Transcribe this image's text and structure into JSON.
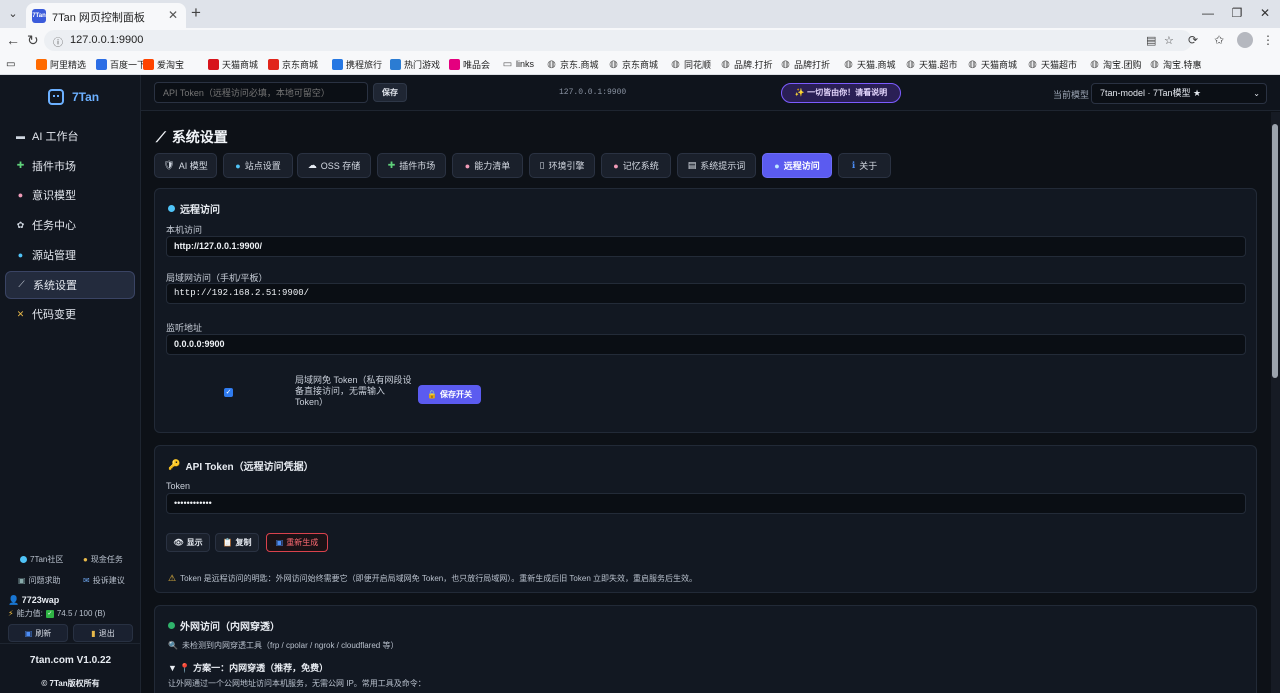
{
  "browser": {
    "tab_title": "7Tan 网页控制面板",
    "tab_favicon": "7Tan",
    "url": "127.0.0.1:9900",
    "bookmarks": [
      {
        "label": "阿里精选",
        "color": "#ff6a00"
      },
      {
        "label": "百度一下",
        "color": "#2b6de5"
      },
      {
        "label": "爱淘宝",
        "color": "#ff4400"
      },
      {
        "label": "天猫商城",
        "color": "#d7141c"
      },
      {
        "label": "京东商城",
        "color": "#e1251b"
      },
      {
        "label": "携程旅行",
        "color": "#2577e3"
      },
      {
        "label": "热门游戏",
        "color": "#2b7cd3"
      },
      {
        "label": "唯品会",
        "color": "#e4007f"
      },
      {
        "label": "links",
        "color": "folder"
      },
      {
        "label": "京东.商城",
        "color": "globe"
      },
      {
        "label": "京东商城",
        "color": "globe"
      },
      {
        "label": "同花顺",
        "color": "globe"
      },
      {
        "label": "品牌.打折",
        "color": "globe"
      },
      {
        "label": "品牌打折",
        "color": "globe"
      },
      {
        "label": "天猫.商城",
        "color": "globe"
      },
      {
        "label": "天猫.超市",
        "color": "globe"
      },
      {
        "label": "天猫商城",
        "color": "globe"
      },
      {
        "label": "天猫超市",
        "color": "globe"
      },
      {
        "label": "淘宝.团购",
        "color": "globe"
      },
      {
        "label": "淘宝.特惠",
        "color": "globe"
      }
    ]
  },
  "sidebar": {
    "logo": "7Tan",
    "items": [
      {
        "label": "AI 工作台",
        "icon": "keyboard-icon"
      },
      {
        "label": "插件市场",
        "icon": "puzzle-icon"
      },
      {
        "label": "意识模型",
        "icon": "brain-icon"
      },
      {
        "label": "任务中心",
        "icon": "gear-icon"
      },
      {
        "label": "源站管理",
        "icon": "globe-icon"
      },
      {
        "label": "系统设置",
        "icon": "wand-icon",
        "active": true
      },
      {
        "label": "代码变更",
        "icon": "tools-icon"
      }
    ],
    "links": {
      "community": "7Tan社区",
      "bounty": "现金任务",
      "help": "问题求助",
      "feedback": "投诉建议"
    },
    "user": "7723wap",
    "ability_label": "能力值:",
    "ability_value": "74.5 / 100 (B)",
    "refresh": "刷新",
    "logout": "退出",
    "version": "7tan.com V1.0.22",
    "copyright": "© 7Tan版权所有"
  },
  "header": {
    "token_placeholder": "API Token（远程访问必填，本地可留空）",
    "save": "保存",
    "address": "127.0.0.1:9900",
    "pill": "✨ 一切皆由你！请看说明",
    "model_label": "当前模型",
    "model_value": "7tan-model · 7Tan模型 ★"
  },
  "page": {
    "title": "系统设置",
    "tabs": [
      {
        "label": "AI 模型",
        "icon": "robot-icon"
      },
      {
        "label": "站点设置",
        "icon": "globe-icon"
      },
      {
        "label": "OSS 存储",
        "icon": "cloud-icon"
      },
      {
        "label": "插件市场",
        "icon": "puzzle-icon"
      },
      {
        "label": "能力清单",
        "icon": "brain-icon"
      },
      {
        "label": "环境引擎",
        "icon": "server-icon"
      },
      {
        "label": "记忆系统",
        "icon": "brain-icon"
      },
      {
        "label": "系统提示词",
        "icon": "doc-icon"
      },
      {
        "label": "远程访问",
        "icon": "globe-icon",
        "active": true
      },
      {
        "label": "关于",
        "icon": "info-icon"
      }
    ]
  },
  "remote": {
    "title": "远程访问",
    "local_label": "本机访问",
    "local_value": "http://127.0.0.1:9900/",
    "lan_label": "局域网访问（手机/平板）",
    "lan_value": "http://192.168.2.51:9900/",
    "listen_label": "监听地址",
    "listen_value": "0.0.0.0:9900",
    "lan_free_line1": "局域网免 Token（私有网段设",
    "lan_free_line2": "备直接访问，无需输入",
    "lan_free_line3": "Token）",
    "lan_free_checked": true,
    "save_switch": "保存开关"
  },
  "api_token": {
    "title": "API Token（远程访问凭据）",
    "token_label": "Token",
    "token_value": "••••••••••••",
    "show": "显示",
    "copy": "复制",
    "regen": "重新生成",
    "note": "Token 是远程访问的明匙：外网访问始终需要它（即便开启局域网免 Token，也只放行局域网）。重新生成后旧 Token 立即失效，重启服务后生效。"
  },
  "tunnel": {
    "title": "外网访问（内网穿透）",
    "detect": "未检测到内网穿透工具（frp / cpolar / ngrok / cloudflared 等）",
    "plan": "▼ 📍 方案一：内网穿透（推荐，免费）",
    "desc": "让外网通过一个公网地址访问本机服务，无需公网 IP。常用工具及命令："
  }
}
